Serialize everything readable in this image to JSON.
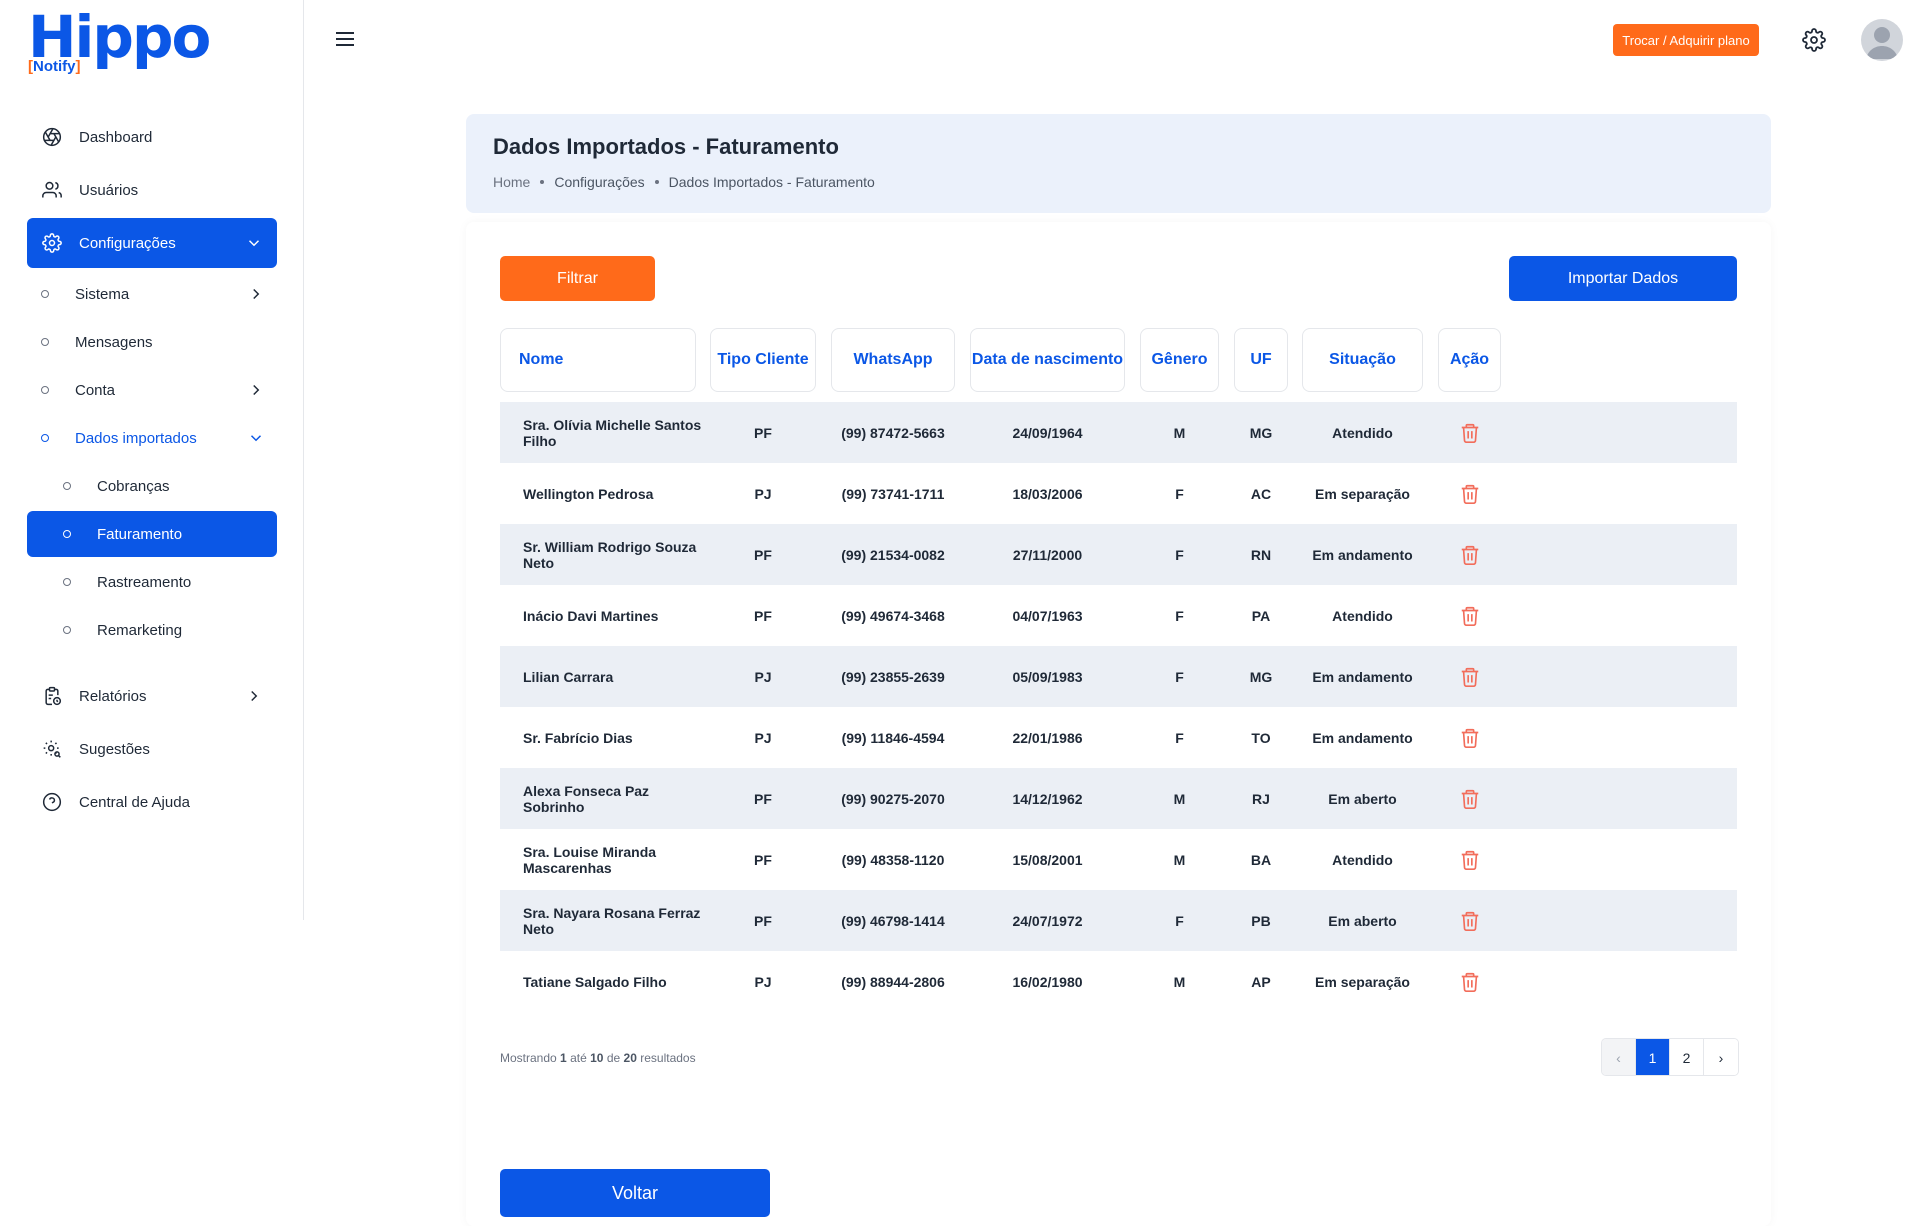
{
  "brand": {
    "name": "Hippo",
    "sub": "Notify",
    "accent": "#0b57e6",
    "orange": "#ff6a1a"
  },
  "sidebar": {
    "items": [
      {
        "label": "Dashboard",
        "icon": "aperture-icon"
      },
      {
        "label": "Usuários",
        "icon": "users-icon"
      },
      {
        "label": "Configurações",
        "icon": "gear-icon",
        "active": true
      },
      {
        "label": "Relatórios",
        "icon": "report-clock-icon"
      },
      {
        "label": "Sugestões",
        "icon": "gear-search-icon"
      },
      {
        "label": "Central de Ajuda",
        "icon": "help-circle-icon"
      }
    ],
    "config_sub": [
      "Sistema",
      "Mensagens",
      "Conta",
      "Dados importados"
    ],
    "dados_sub": [
      "Cobranças",
      "Faturamento",
      "Rastreamento",
      "Remarketing"
    ]
  },
  "topbar": {
    "plan_button": "Trocar / Adquirir plano"
  },
  "header": {
    "title": "Dados Importados - Faturamento",
    "breadcrumb": [
      "Home",
      "Configurações",
      "Dados Importados - Faturamento"
    ]
  },
  "actions": {
    "filter": "Filtrar",
    "import": "Importar Dados",
    "back": "Voltar"
  },
  "table": {
    "columns": [
      "Nome",
      "Tipo Cliente",
      "WhatsApp",
      "Data de nascimento",
      "Gênero",
      "UF",
      "Situação",
      "Ação"
    ],
    "rows": [
      [
        "Sra. Olívia Michelle Santos Filho",
        "PF",
        "(99) 87472-5663",
        "24/09/1964",
        "M",
        "MG",
        "Atendido"
      ],
      [
        "Wellington Pedrosa",
        "PJ",
        "(99) 73741-1711",
        "18/03/2006",
        "F",
        "AC",
        "Em separação"
      ],
      [
        "Sr. William Rodrigo Souza Neto",
        "PF",
        "(99) 21534-0082",
        "27/11/2000",
        "F",
        "RN",
        "Em andamento"
      ],
      [
        "Inácio Davi Martines",
        "PF",
        "(99) 49674-3468",
        "04/07/1963",
        "F",
        "PA",
        "Atendido"
      ],
      [
        "Lilian Carrara",
        "PJ",
        "(99) 23855-2639",
        "05/09/1983",
        "F",
        "MG",
        "Em andamento"
      ],
      [
        "Sr. Fabrício Dias",
        "PJ",
        "(99) 11846-4594",
        "22/01/1986",
        "F",
        "TO",
        "Em andamento"
      ],
      [
        "Alexa Fonseca Paz Sobrinho",
        "PF",
        "(99) 90275-2070",
        "14/12/1962",
        "M",
        "RJ",
        "Em aberto"
      ],
      [
        "Sra. Louise Miranda Mascarenhas",
        "PF",
        "(99) 48358-1120",
        "15/08/2001",
        "M",
        "BA",
        "Atendido"
      ],
      [
        "Sra. Nayara Rosana Ferraz Neto",
        "PF",
        "(99) 46798-1414",
        "24/07/1972",
        "F",
        "PB",
        "Em aberto"
      ],
      [
        "Tatiane Salgado Filho",
        "PJ",
        "(99) 88944-2806",
        "16/02/1980",
        "M",
        "AP",
        "Em separação"
      ]
    ]
  },
  "pagination": {
    "prefix": "Mostrando",
    "from": "1",
    "mid1": "até",
    "to": "10",
    "mid2": "de",
    "total": "20",
    "suffix": "resultados",
    "prev": "‹",
    "pages": [
      "1",
      "2"
    ],
    "next": "›",
    "current": "1"
  }
}
